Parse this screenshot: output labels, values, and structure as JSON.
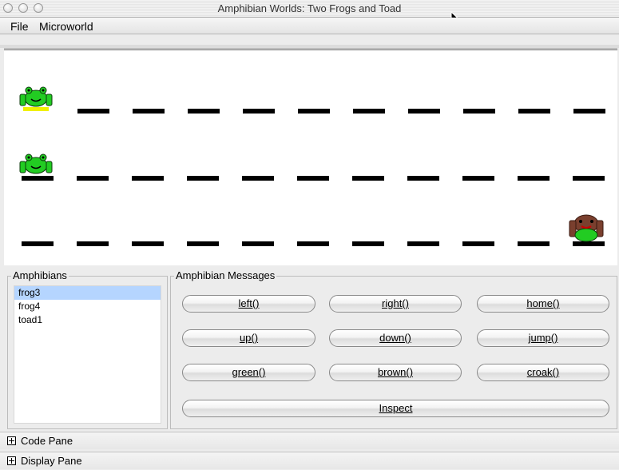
{
  "window": {
    "title": "Amphibian Worlds: Two Frogs and Toad"
  },
  "menu": {
    "file": "File",
    "microworld": "Microworld"
  },
  "world": {
    "rows": [
      {
        "frog": "green",
        "highlighted": true
      },
      {
        "frog": "green",
        "highlighted": false
      },
      {
        "frog": "brown",
        "highlighted": false
      }
    ],
    "colors": {
      "green": "#33ee33",
      "brown": "#7a3f2e",
      "highlight": "#f0f000"
    }
  },
  "amphibians": {
    "label": "Amphibians",
    "items": [
      "frog3",
      "frog4",
      "toad1"
    ],
    "selected": "frog3"
  },
  "messages": {
    "label": "Amphibian Messages",
    "left": "left()",
    "right": "right()",
    "home": "home()",
    "up": "up()",
    "down": "down()",
    "jump": "jump()",
    "green": "green()",
    "brown": "brown()",
    "croak": "croak()",
    "inspect": "Inspect"
  },
  "panes": {
    "code": "Code Pane",
    "display": "Display Pane"
  },
  "icons": [
    "close-icon",
    "minimize-icon",
    "zoom-icon",
    "mouse-pointer-icon",
    "frog-icon",
    "toad-icon",
    "expand-plus-icon"
  ]
}
